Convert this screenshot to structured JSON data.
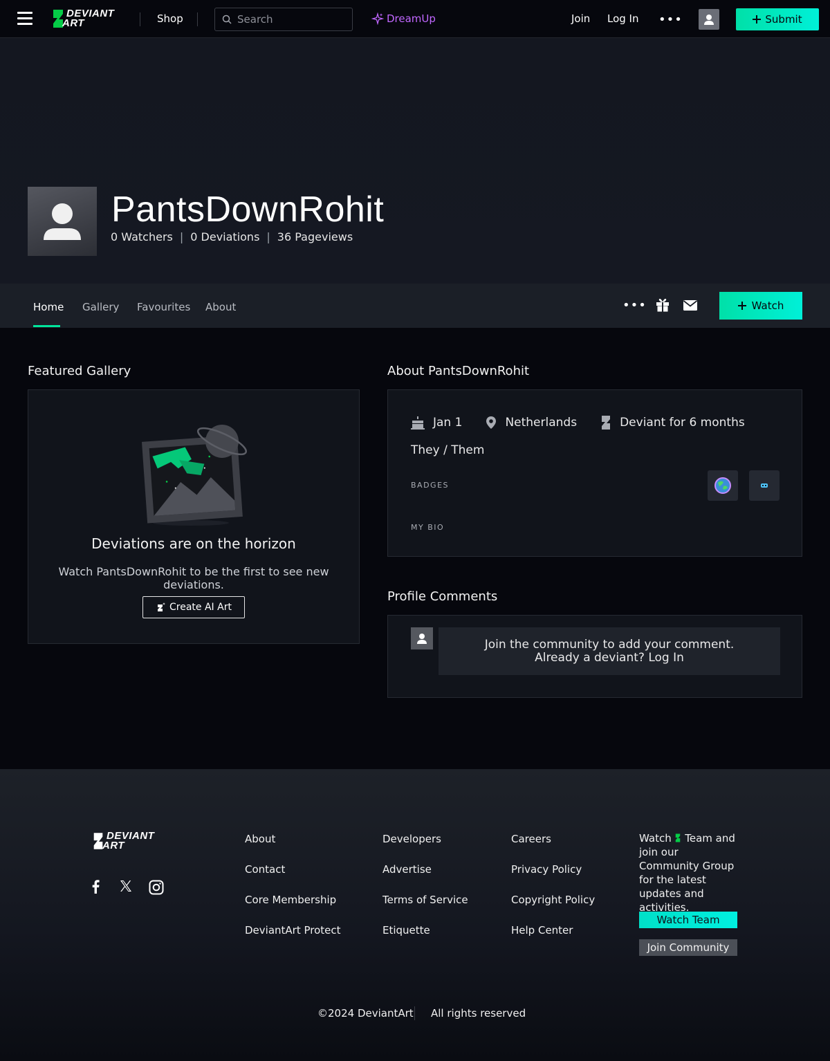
{
  "topbar": {
    "logo_line1": "DEVIANT",
    "logo_line2": "ART",
    "shop": "Shop",
    "search_placeholder": "Search",
    "dreamup": "DreamUp",
    "join": "Join",
    "login": "Log In",
    "more": "•••",
    "submit": "Submit"
  },
  "profile": {
    "username": "PantsDownRohit",
    "stats": [
      {
        "value": "0",
        "label": "Watchers"
      },
      {
        "value": "0",
        "label": "Deviations"
      },
      {
        "value": "36",
        "label": "Pageviews"
      }
    ],
    "separator": "|"
  },
  "tabs": {
    "items": [
      "Home",
      "Gallery",
      "Favourites",
      "About"
    ],
    "active": "Home",
    "more": "•••",
    "watch": "Watch"
  },
  "featured": {
    "heading": "Featured Gallery",
    "empty_title": "Deviations are on the horizon",
    "empty_sub": "Watch PantsDownRohit to be the first to see new deviations.",
    "create_button": "Create AI Art"
  },
  "about": {
    "heading": "About PantsDownRohit",
    "birthday": "Jan 1",
    "location": "Netherlands",
    "membership": "Deviant for 6 months",
    "pronouns": "They / Them",
    "badges_label": "BADGES",
    "bio_label": "MY BIO"
  },
  "comments": {
    "heading": "Profile Comments",
    "prompt": "Join the community to add your comment. Already a deviant? Log In"
  },
  "footer": {
    "logo_line1": "DEVIANT",
    "logo_line2": "ART",
    "col1": [
      "About",
      "Contact",
      "Core Membership",
      "DeviantArt Protect"
    ],
    "col2": [
      "Developers",
      "Advertise",
      "Terms of Service",
      "Etiquette"
    ],
    "col3": [
      "Careers",
      "Privacy Policy",
      "Copyright Policy",
      "Help Center"
    ],
    "community_text_a": "Watch",
    "community_text_b": "Team and join our Community Group for the latest updates and activities.",
    "watch_team": "Watch Team",
    "join_community": "Join Community",
    "copyright": "©2024 DeviantArt",
    "rights": "All rights reserved"
  },
  "colors": {
    "accent": "#00e59b",
    "dreamup": "#c067ff",
    "background": "#06070d"
  }
}
